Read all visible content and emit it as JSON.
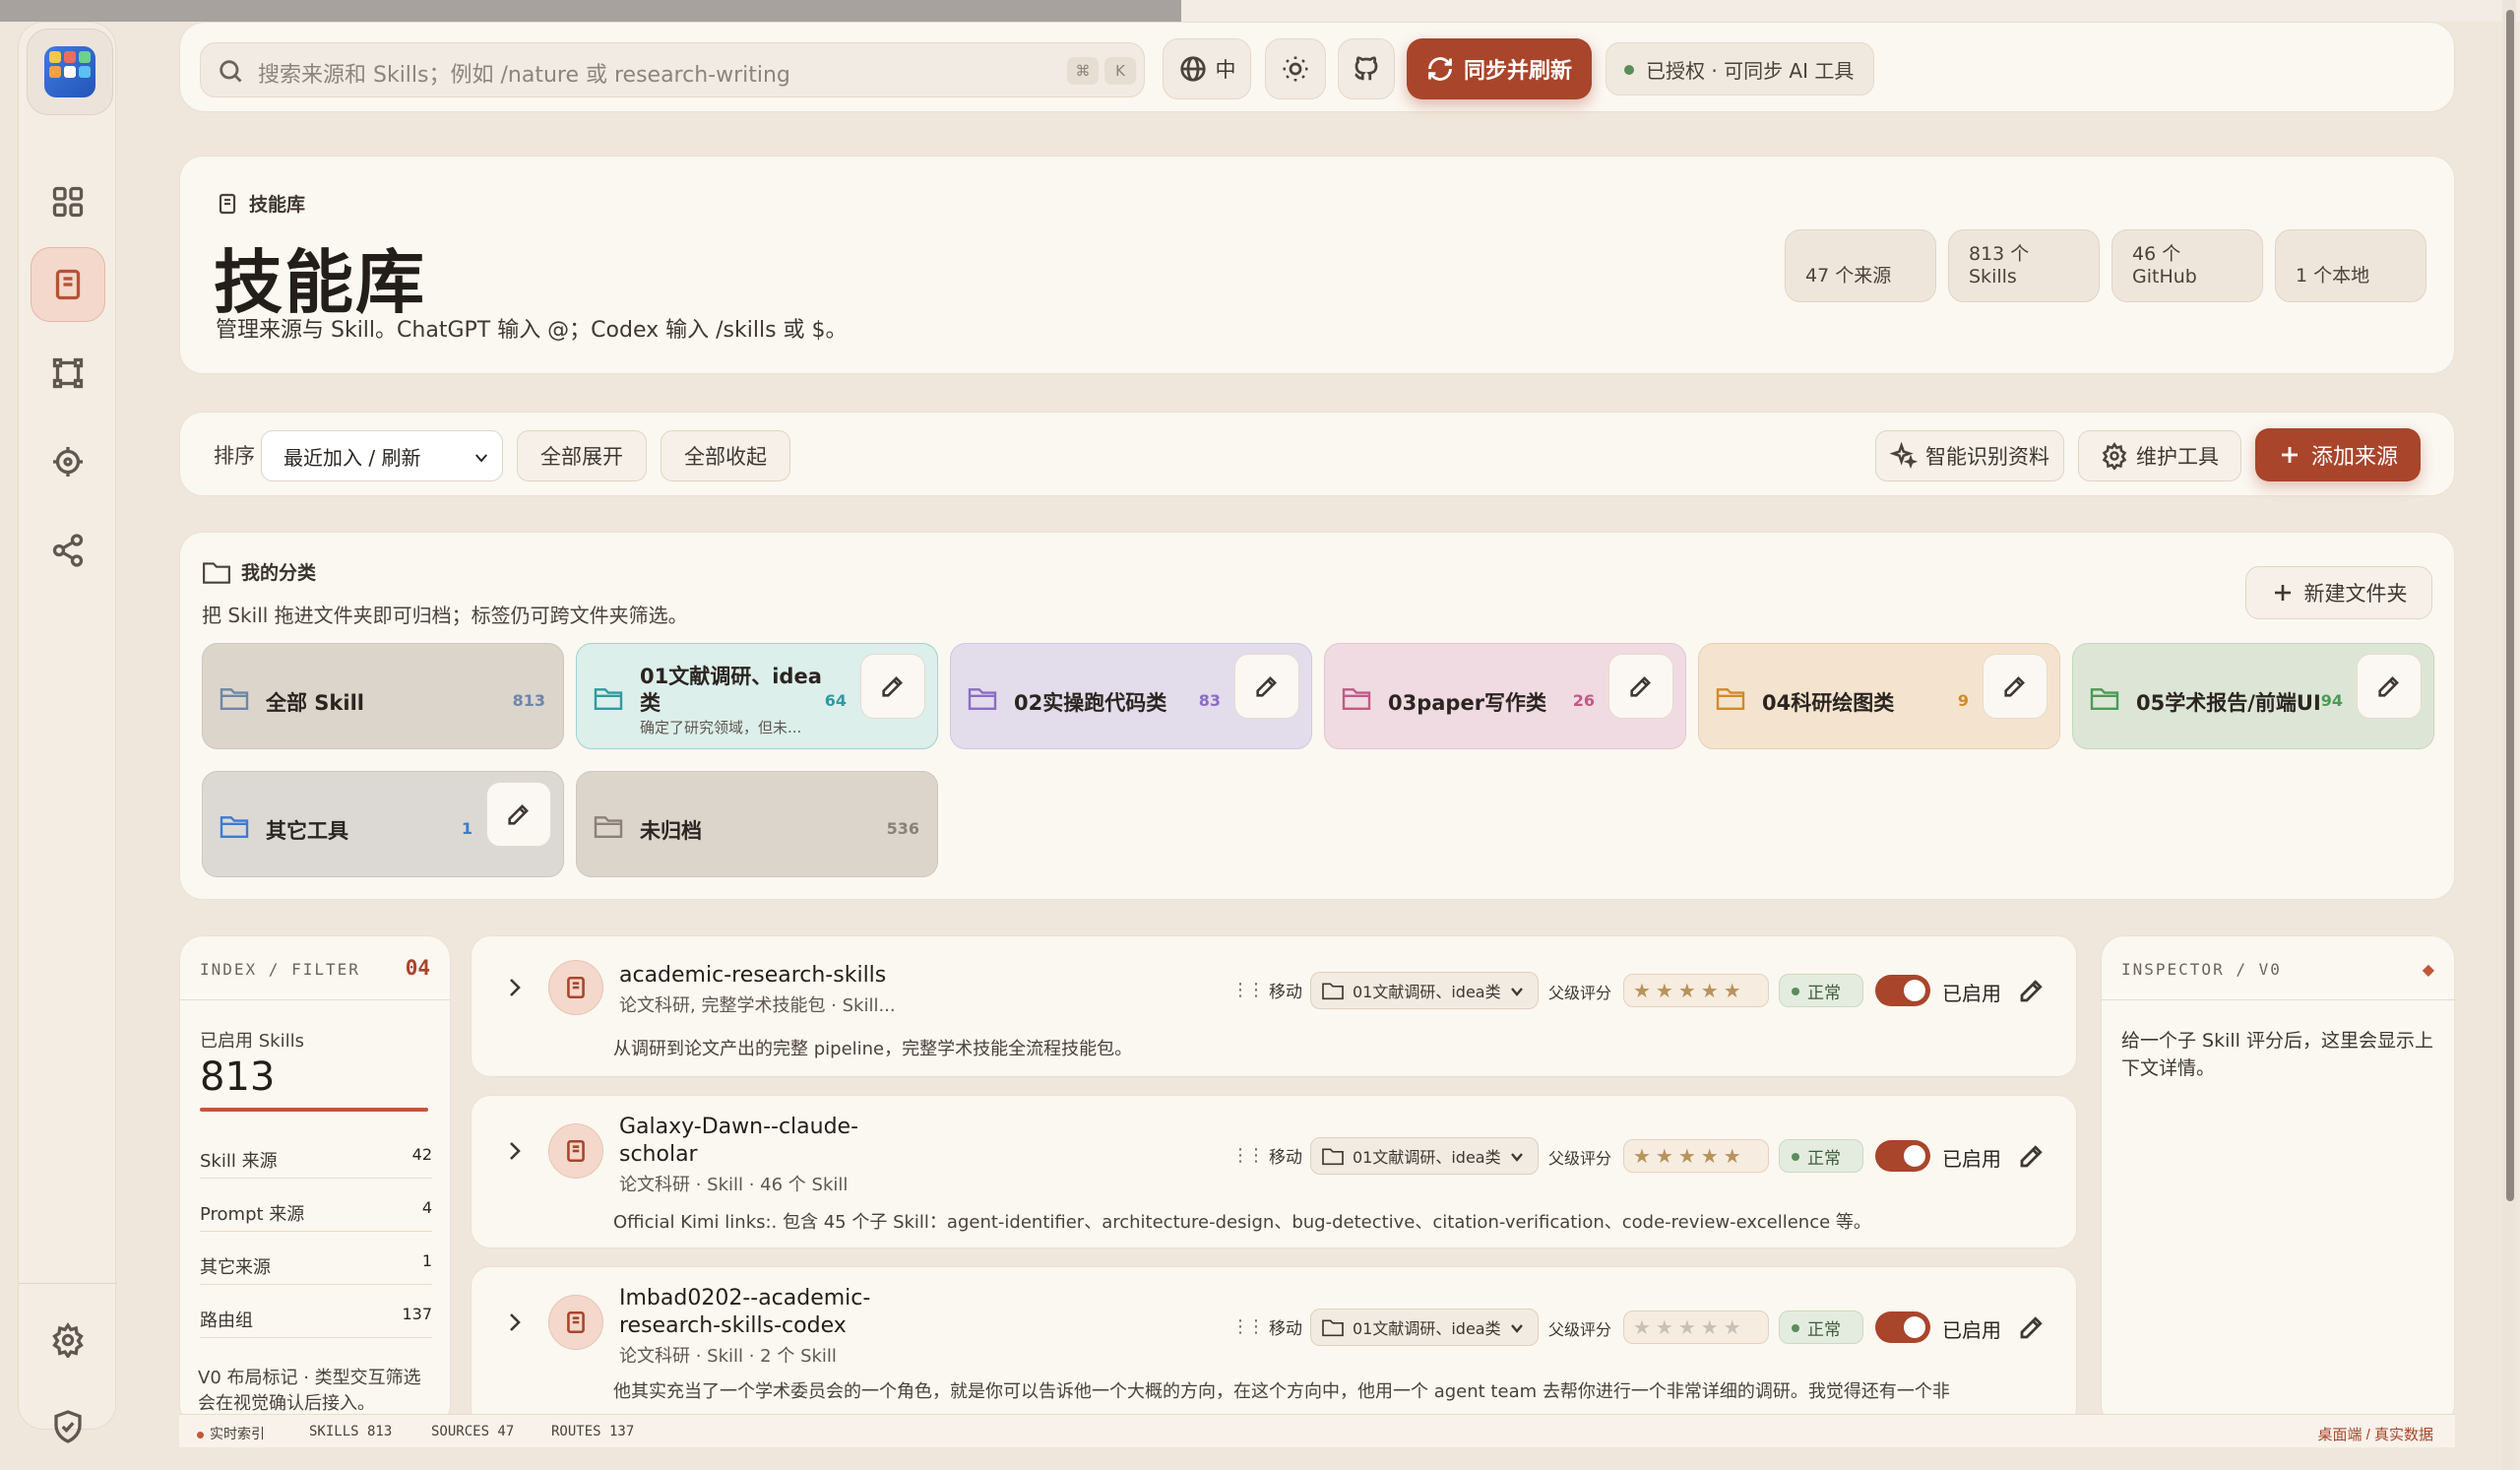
{
  "topbar": {
    "search_placeholder": "搜索来源和 Skills；例如 /nature 或 research-writing",
    "kbd_cmd": "⌘",
    "kbd_k": "K",
    "lang_label": "中",
    "sync_label": "同步并刷新",
    "status_label": "已授权 · 可同步 AI 工具"
  },
  "header": {
    "crumb": "技能库",
    "title": "技能库",
    "subtitle": "管理来源与 Skill。ChatGPT 输入 @；Codex 输入 /skills 或 $。",
    "stats": [
      "47 个来源",
      "813 个 Skills",
      "46 个 GitHub",
      "1 个本地"
    ]
  },
  "toolbar": {
    "sort_label": "排序",
    "sort_value": "最近加入 / 刷新",
    "expand_all": "全部展开",
    "collapse_all": "全部收起",
    "smart_identify": "智能识别资料",
    "maintenance": "维护工具",
    "add_source": "添加来源"
  },
  "categories": {
    "title": "我的分类",
    "hint": "把 Skill 拖进文件夹即可归档；标签仍可跨文件夹筛选。",
    "new_folder": "新建文件夹",
    "folders": [
      {
        "name": "全部 Skill",
        "count": "813",
        "color": "#6e86a8"
      },
      {
        "name": "01文献调研、idea类",
        "desc": "确定了研究领域，但未...",
        "count": "64",
        "color": "#2f9aa0"
      },
      {
        "name": "02实操跑代码类",
        "count": "83",
        "color": "#8a6cc8"
      },
      {
        "name": "03paper写作类",
        "count": "26",
        "color": "#c25a85"
      },
      {
        "name": "04科研绘图类",
        "count": "9",
        "color": "#d08a2c"
      },
      {
        "name": "05学术报告/前端UI",
        "count": "94",
        "color": "#4c9a55"
      },
      {
        "name": "其它工具",
        "count": "1",
        "color": "#3d7bd0"
      },
      {
        "name": "未归档",
        "count": "536",
        "color": "#8a817a"
      }
    ]
  },
  "index": {
    "head": "INDEX / FILTER",
    "num": "04",
    "enabled_label": "已启用 Skills",
    "enabled_value": "813",
    "rows": [
      {
        "label": "Skill 来源",
        "value": "42"
      },
      {
        "label": "Prompt 来源",
        "value": "4"
      },
      {
        "label": "其它来源",
        "value": "1"
      },
      {
        "label": "路由组",
        "value": "137"
      }
    ],
    "note": "V0 布局标记 · 类型交互筛选会在视觉确认后接入。"
  },
  "skills": [
    {
      "name": "academic-research-skills",
      "meta": "论文科研, 完整学术技能包 · Skill...",
      "desc": "从调研到论文产出的完整 pipeline，完整学术技能全流程技能包。",
      "move": "移动",
      "folder": "01文献调研、idea类",
      "parent_rating_label": "父级评分",
      "stars": "★★★★★",
      "status": "正常",
      "enabled": "已启用"
    },
    {
      "name": "Galaxy-Dawn--claude-scholar",
      "meta": "论文科研 · Skill · 46 个 Skill",
      "desc": "Official Kimi links:. 包含 45 个子 Skill：agent-identifier、architecture-design、bug-detective、citation-verification、code-review-excellence 等。",
      "move": "移动",
      "folder": "01文献调研、idea类",
      "parent_rating_label": "父级评分",
      "stars": "★★★★★",
      "status": "正常",
      "enabled": "已启用"
    },
    {
      "name": "Imbad0202--academic-research-skills-codex",
      "meta": "论文科研 · Skill · 2 个 Skill",
      "desc": "他其实充当了一个学术委员会的一个角色，就是你可以告诉他一个大概的方向，在这个方向中，他用一个 agent team 去帮你进行一个非常详细的调研。我觉得还有一个非",
      "move": "移动",
      "folder": "01文献调研、idea类",
      "parent_rating_label": "父级评分",
      "stars": "★★★★★",
      "status": "正常",
      "enabled": "已启用"
    }
  ],
  "inspector": {
    "head": "INSPECTOR / V0",
    "diamond": "◆",
    "message": "给一个子 Skill 评分后，这里会显示上下文详情。"
  },
  "footer": {
    "live": "实时索引",
    "skills": "SKILLS 813",
    "sources": "SOURCES 47",
    "routes": "ROUTES 137",
    "right": "桌面端 / 真实数据"
  },
  "colors": {
    "accent": "#a9452b",
    "background": "#efe7dc",
    "card": "#fbf7f1",
    "ok_green": "#5c8c5b"
  },
  "icons": [
    "search-icon",
    "globe-icon",
    "sun-icon",
    "github-icon",
    "refresh-icon",
    "grid-icon",
    "book-icon",
    "nodes-icon",
    "target-icon",
    "share-icon",
    "settings-icon",
    "shield-icon",
    "folder-icon",
    "pencil-icon",
    "sparkle-icon",
    "plus-icon",
    "chevron-right-icon"
  ]
}
